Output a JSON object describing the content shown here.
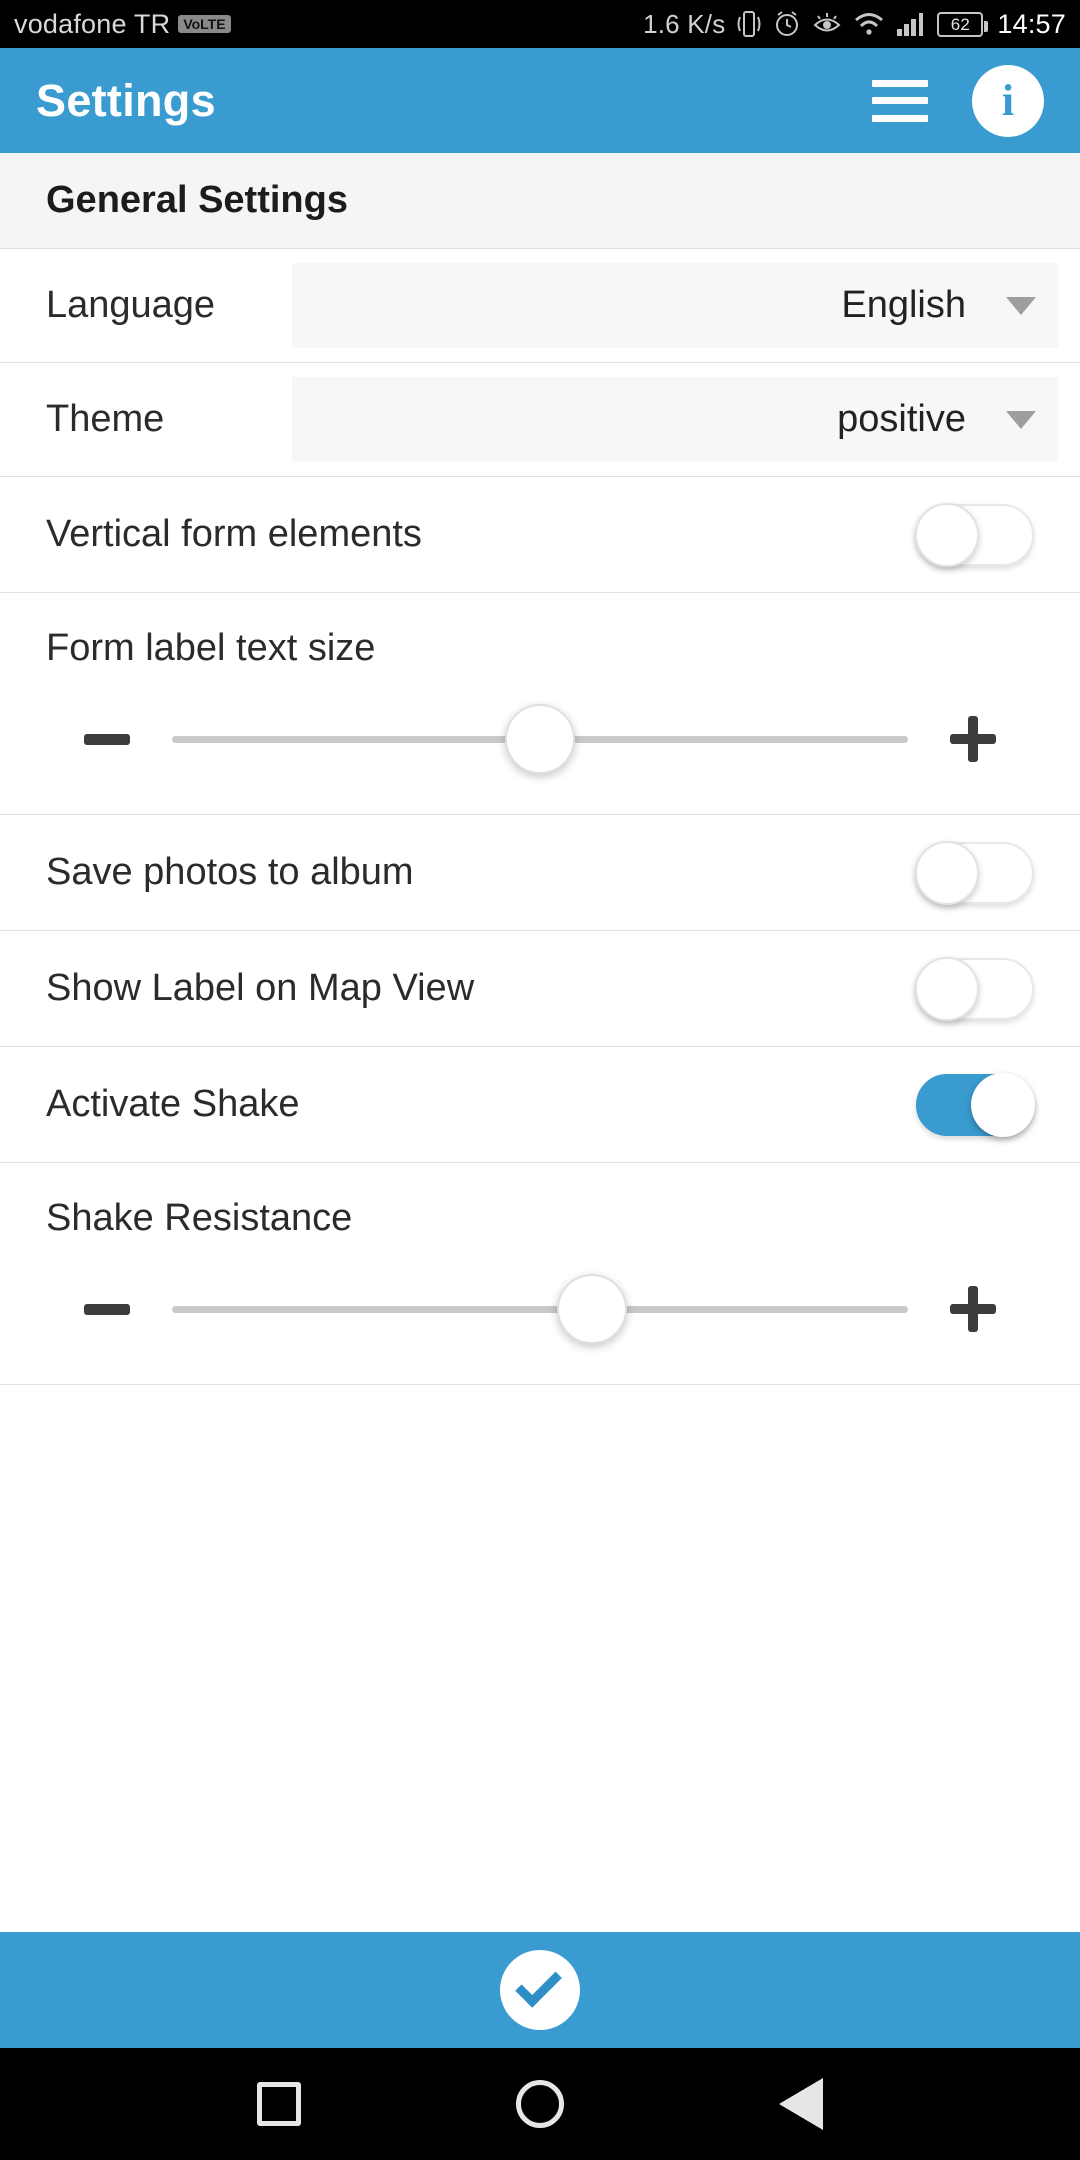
{
  "statusbar": {
    "carrier": "vodafone TR",
    "volte_badge": "VoLTE",
    "net_speed": "1.6 K/s",
    "battery_percent": "62",
    "time": "14:57",
    "icons": [
      "vibrate-icon",
      "alarm-clock-icon",
      "eye-care-icon",
      "wifi-icon",
      "cellular-signal-icon",
      "battery-icon"
    ]
  },
  "appbar": {
    "title": "Settings",
    "menu_icon": "hamburger-menu-icon",
    "info_icon": "info-icon"
  },
  "section": {
    "title": "General Settings"
  },
  "rows": {
    "language": {
      "label": "Language",
      "value": "English"
    },
    "theme": {
      "label": "Theme",
      "value": "positive"
    },
    "vertical_form": {
      "label": "Vertical form elements",
      "state": "off"
    },
    "form_label_text_size": {
      "label": "Form label text size",
      "minus": "minus",
      "plus": "plus",
      "position_percent": 50
    },
    "save_photos": {
      "label": "Save photos to album",
      "state": "off"
    },
    "show_label_map": {
      "label": "Show Label on Map View",
      "state": "off"
    },
    "activate_shake": {
      "label": "Activate Shake",
      "state": "on"
    },
    "shake_resistance": {
      "label": "Shake Resistance",
      "minus": "minus",
      "plus": "plus",
      "position_percent": 57
    }
  },
  "footer": {
    "save_icon": "checkmark-icon"
  },
  "navbar": {
    "recents": "square-recents-icon",
    "home": "circle-home-icon",
    "back": "triangle-back-icon"
  },
  "colors": {
    "accent": "#3a9bd0",
    "section_bg": "#f5f5f5",
    "select_bg": "#f7f7f7",
    "text": "#2b2b2b"
  }
}
